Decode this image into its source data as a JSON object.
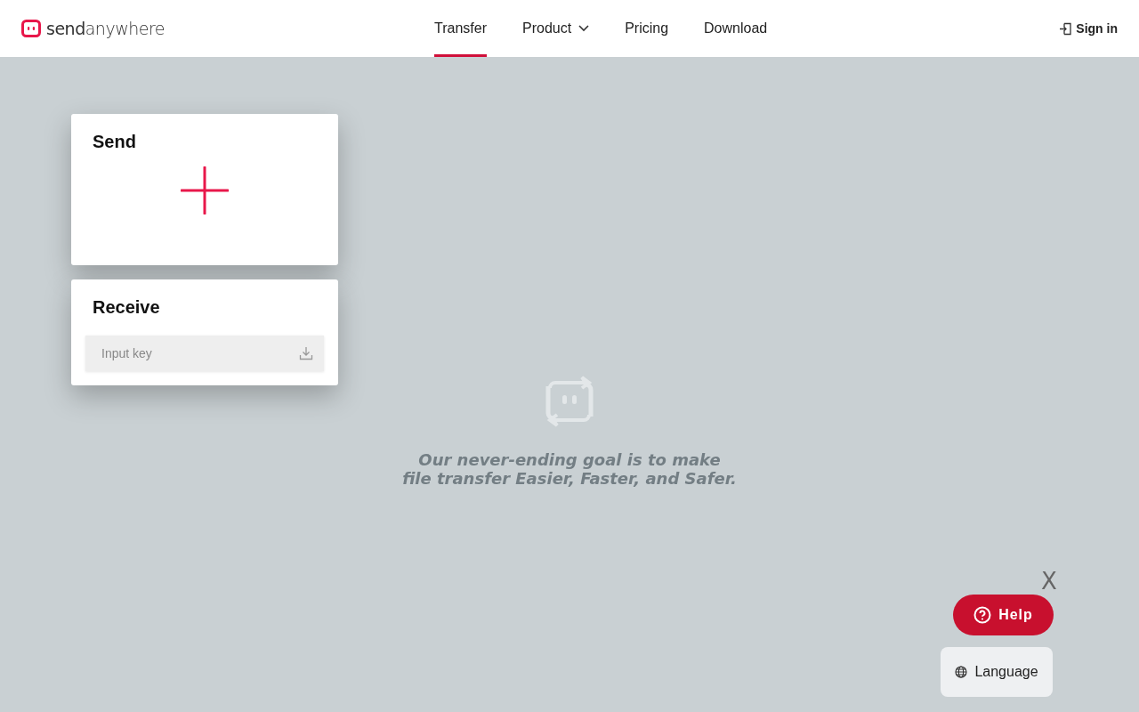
{
  "header": {
    "logo": "**send**anywhere",
    "nav": [
      {
        "label": "Transfer",
        "selected": true,
        "dropdown": false
      },
      {
        "label": "Product",
        "selected": false,
        "dropdown": true
      },
      {
        "label": "Pricing",
        "selected": false,
        "dropdown": false
      },
      {
        "label": "Download",
        "selected": false,
        "dropdown": false
      }
    ],
    "sign_in": "Sign in"
  },
  "send_card": {
    "title": "Send"
  },
  "receive_card": {
    "title": "Receive",
    "placeholder": "Input key"
  },
  "tagline": [
    "Our never-ending goal is to make",
    "file transfer Easier, Faster, and Safer."
  ],
  "help": {
    "close": "X",
    "label": "Help"
  },
  "language": "Language"
}
